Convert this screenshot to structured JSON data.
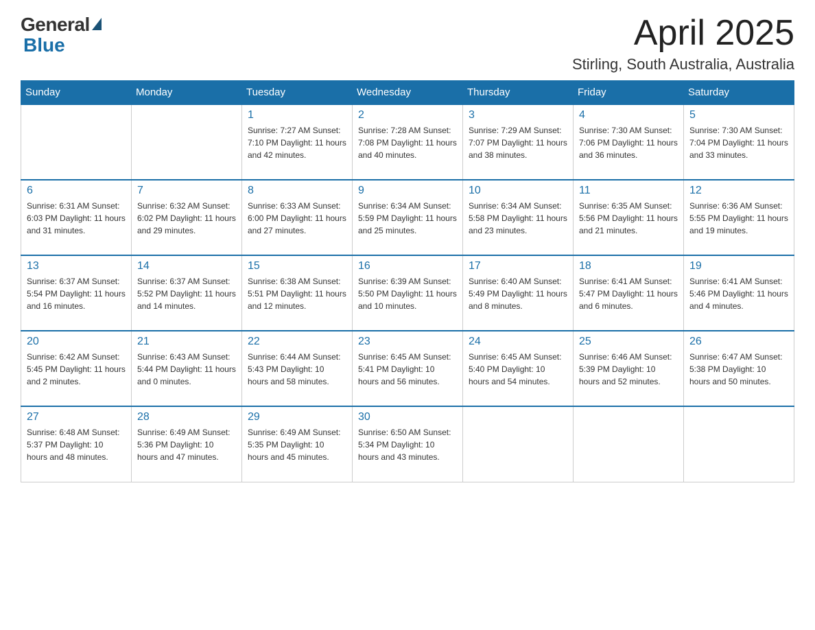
{
  "logo": {
    "general": "General",
    "blue": "Blue"
  },
  "title": "April 2025",
  "location": "Stirling, South Australia, Australia",
  "days_of_week": [
    "Sunday",
    "Monday",
    "Tuesday",
    "Wednesday",
    "Thursday",
    "Friday",
    "Saturday"
  ],
  "weeks": [
    [
      {
        "day": "",
        "info": ""
      },
      {
        "day": "",
        "info": ""
      },
      {
        "day": "1",
        "info": "Sunrise: 7:27 AM\nSunset: 7:10 PM\nDaylight: 11 hours\nand 42 minutes."
      },
      {
        "day": "2",
        "info": "Sunrise: 7:28 AM\nSunset: 7:08 PM\nDaylight: 11 hours\nand 40 minutes."
      },
      {
        "day": "3",
        "info": "Sunrise: 7:29 AM\nSunset: 7:07 PM\nDaylight: 11 hours\nand 38 minutes."
      },
      {
        "day": "4",
        "info": "Sunrise: 7:30 AM\nSunset: 7:06 PM\nDaylight: 11 hours\nand 36 minutes."
      },
      {
        "day": "5",
        "info": "Sunrise: 7:30 AM\nSunset: 7:04 PM\nDaylight: 11 hours\nand 33 minutes."
      }
    ],
    [
      {
        "day": "6",
        "info": "Sunrise: 6:31 AM\nSunset: 6:03 PM\nDaylight: 11 hours\nand 31 minutes."
      },
      {
        "day": "7",
        "info": "Sunrise: 6:32 AM\nSunset: 6:02 PM\nDaylight: 11 hours\nand 29 minutes."
      },
      {
        "day": "8",
        "info": "Sunrise: 6:33 AM\nSunset: 6:00 PM\nDaylight: 11 hours\nand 27 minutes."
      },
      {
        "day": "9",
        "info": "Sunrise: 6:34 AM\nSunset: 5:59 PM\nDaylight: 11 hours\nand 25 minutes."
      },
      {
        "day": "10",
        "info": "Sunrise: 6:34 AM\nSunset: 5:58 PM\nDaylight: 11 hours\nand 23 minutes."
      },
      {
        "day": "11",
        "info": "Sunrise: 6:35 AM\nSunset: 5:56 PM\nDaylight: 11 hours\nand 21 minutes."
      },
      {
        "day": "12",
        "info": "Sunrise: 6:36 AM\nSunset: 5:55 PM\nDaylight: 11 hours\nand 19 minutes."
      }
    ],
    [
      {
        "day": "13",
        "info": "Sunrise: 6:37 AM\nSunset: 5:54 PM\nDaylight: 11 hours\nand 16 minutes."
      },
      {
        "day": "14",
        "info": "Sunrise: 6:37 AM\nSunset: 5:52 PM\nDaylight: 11 hours\nand 14 minutes."
      },
      {
        "day": "15",
        "info": "Sunrise: 6:38 AM\nSunset: 5:51 PM\nDaylight: 11 hours\nand 12 minutes."
      },
      {
        "day": "16",
        "info": "Sunrise: 6:39 AM\nSunset: 5:50 PM\nDaylight: 11 hours\nand 10 minutes."
      },
      {
        "day": "17",
        "info": "Sunrise: 6:40 AM\nSunset: 5:49 PM\nDaylight: 11 hours\nand 8 minutes."
      },
      {
        "day": "18",
        "info": "Sunrise: 6:41 AM\nSunset: 5:47 PM\nDaylight: 11 hours\nand 6 minutes."
      },
      {
        "day": "19",
        "info": "Sunrise: 6:41 AM\nSunset: 5:46 PM\nDaylight: 11 hours\nand 4 minutes."
      }
    ],
    [
      {
        "day": "20",
        "info": "Sunrise: 6:42 AM\nSunset: 5:45 PM\nDaylight: 11 hours\nand 2 minutes."
      },
      {
        "day": "21",
        "info": "Sunrise: 6:43 AM\nSunset: 5:44 PM\nDaylight: 11 hours\nand 0 minutes."
      },
      {
        "day": "22",
        "info": "Sunrise: 6:44 AM\nSunset: 5:43 PM\nDaylight: 10 hours\nand 58 minutes."
      },
      {
        "day": "23",
        "info": "Sunrise: 6:45 AM\nSunset: 5:41 PM\nDaylight: 10 hours\nand 56 minutes."
      },
      {
        "day": "24",
        "info": "Sunrise: 6:45 AM\nSunset: 5:40 PM\nDaylight: 10 hours\nand 54 minutes."
      },
      {
        "day": "25",
        "info": "Sunrise: 6:46 AM\nSunset: 5:39 PM\nDaylight: 10 hours\nand 52 minutes."
      },
      {
        "day": "26",
        "info": "Sunrise: 6:47 AM\nSunset: 5:38 PM\nDaylight: 10 hours\nand 50 minutes."
      }
    ],
    [
      {
        "day": "27",
        "info": "Sunrise: 6:48 AM\nSunset: 5:37 PM\nDaylight: 10 hours\nand 48 minutes."
      },
      {
        "day": "28",
        "info": "Sunrise: 6:49 AM\nSunset: 5:36 PM\nDaylight: 10 hours\nand 47 minutes."
      },
      {
        "day": "29",
        "info": "Sunrise: 6:49 AM\nSunset: 5:35 PM\nDaylight: 10 hours\nand 45 minutes."
      },
      {
        "day": "30",
        "info": "Sunrise: 6:50 AM\nSunset: 5:34 PM\nDaylight: 10 hours\nand 43 minutes."
      },
      {
        "day": "",
        "info": ""
      },
      {
        "day": "",
        "info": ""
      },
      {
        "day": "",
        "info": ""
      }
    ]
  ]
}
